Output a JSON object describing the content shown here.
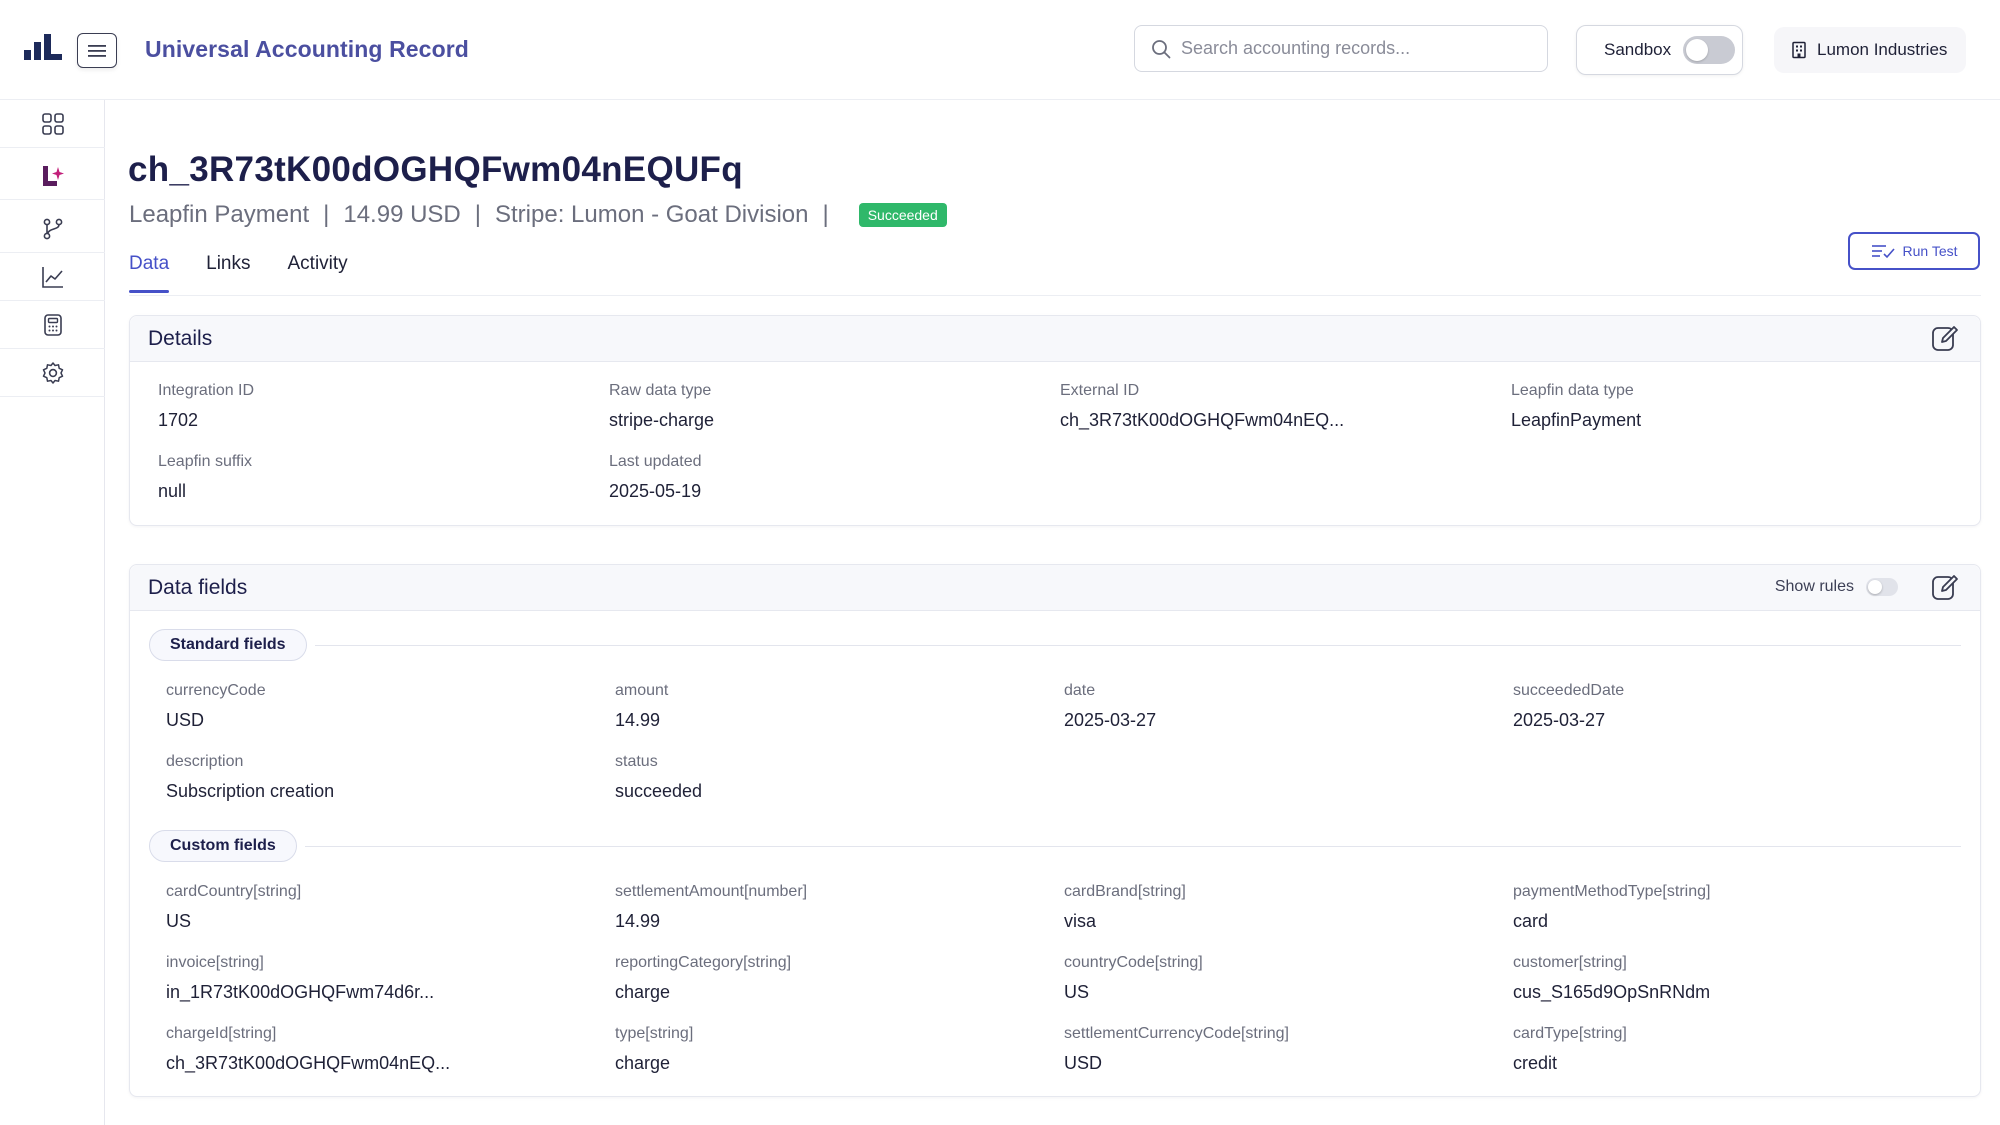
{
  "header": {
    "app_title": "Universal Accounting Record",
    "search_placeholder": "Search accounting records...",
    "sandbox_label": "Sandbox",
    "sandbox_on": false,
    "org_name": "Lumon Industries"
  },
  "sidebar": {
    "items": [
      {
        "icon": "dashboard-grid-icon"
      },
      {
        "icon": "leapfin-logo-icon",
        "active": true
      },
      {
        "icon": "branch-icon"
      },
      {
        "icon": "line-chart-icon"
      },
      {
        "icon": "calculator-icon"
      },
      {
        "icon": "settings-gear-icon"
      }
    ]
  },
  "record": {
    "id": "ch_3R73tK00dOGHQFwm04nEQUFq",
    "type": "Leapfin Payment",
    "amount": "14.99 USD",
    "source": "Stripe: Lumon - Goat Division",
    "status": "Succeeded",
    "separator": "|"
  },
  "tabs": [
    "Data",
    "Links",
    "Activity"
  ],
  "run_test_label": "Run Test",
  "details": {
    "title": "Details",
    "fields": [
      {
        "label": "Integration ID",
        "value": "1702"
      },
      {
        "label": "Raw data type",
        "value": "stripe-charge"
      },
      {
        "label": "External ID",
        "value": "ch_3R73tK00dOGHQFwm04nEQ..."
      },
      {
        "label": "Leapfin data type",
        "value": "LeapfinPayment"
      },
      {
        "label": "Leapfin suffix",
        "value": "null"
      },
      {
        "label": "Last updated",
        "value": "2025-05-19"
      }
    ]
  },
  "data_fields": {
    "title": "Data fields",
    "show_rules_label": "Show rules",
    "standard_label": "Standard fields",
    "standard": [
      {
        "label": "currencyCode",
        "value": "USD"
      },
      {
        "label": "amount",
        "value": "14.99"
      },
      {
        "label": "date",
        "value": "2025-03-27"
      },
      {
        "label": "succeededDate",
        "value": "2025-03-27"
      },
      {
        "label": "description",
        "value": "Subscription creation"
      },
      {
        "label": "status",
        "value": "succeeded"
      }
    ],
    "custom_label": "Custom fields",
    "custom": [
      {
        "label": "cardCountry[string]",
        "value": "US"
      },
      {
        "label": "settlementAmount[number]",
        "value": "14.99"
      },
      {
        "label": "cardBrand[string]",
        "value": "visa"
      },
      {
        "label": "paymentMethodType[string]",
        "value": "card"
      },
      {
        "label": "invoice[string]",
        "value": "in_1R73tK00dOGHQFwm74d6r..."
      },
      {
        "label": "reportingCategory[string]",
        "value": "charge"
      },
      {
        "label": "countryCode[string]",
        "value": "US"
      },
      {
        "label": "customer[string]",
        "value": "cus_S165d9OpSnRNdm"
      },
      {
        "label": "chargeId[string]",
        "value": "ch_3R73tK00dOGHQFwm04nEQ..."
      },
      {
        "label": "type[string]",
        "value": "charge"
      },
      {
        "label": "settlementCurrencyCode[string]",
        "value": "USD"
      },
      {
        "label": "cardType[string]",
        "value": "credit"
      }
    ]
  },
  "colors": {
    "accent": "#4651c8",
    "title": "#1d1f4b",
    "success": "#2fb86a",
    "brand_magenta": "#9b1f6e",
    "brand_navy": "#1d2a5a"
  }
}
